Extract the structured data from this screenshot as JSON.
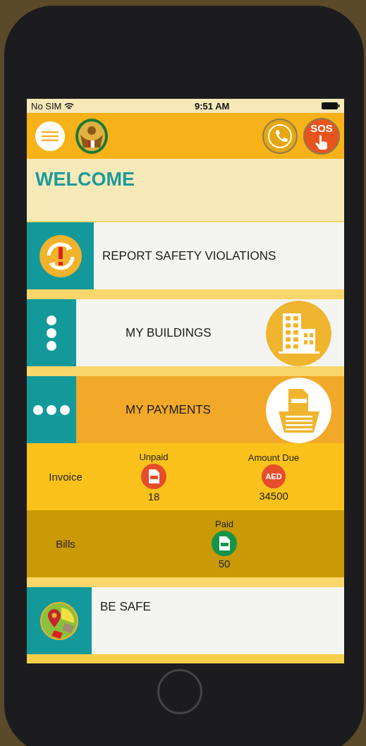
{
  "status_bar": {
    "carrier": "No SIM",
    "time": "9:51 AM"
  },
  "header": {
    "sos_button": {
      "label": "SOS"
    }
  },
  "welcome": "WELCOME",
  "menu": [
    {
      "kind": "report",
      "label": "REPORT SAFETY VIOLATIONS",
      "expanded": false
    },
    {
      "kind": "buildings",
      "label": "MY BUILDINGS",
      "expanded": false
    },
    {
      "kind": "payments",
      "label": "MY PAYMENTS",
      "expanded": true,
      "rows": [
        {
          "label": "Invoice",
          "stats": [
            {
              "kind": "unpaid",
              "label": "Unpaid",
              "value": "18"
            },
            {
              "kind": "amount",
              "label": "Amount Due",
              "value": "34500",
              "badge": "AED"
            }
          ]
        },
        {
          "label": "Bills",
          "stats": [
            {
              "kind": "paid",
              "label": "Paid",
              "value": "50"
            }
          ]
        }
      ]
    },
    {
      "kind": "safe",
      "label": "BE SAFE",
      "expanded": false
    }
  ]
}
